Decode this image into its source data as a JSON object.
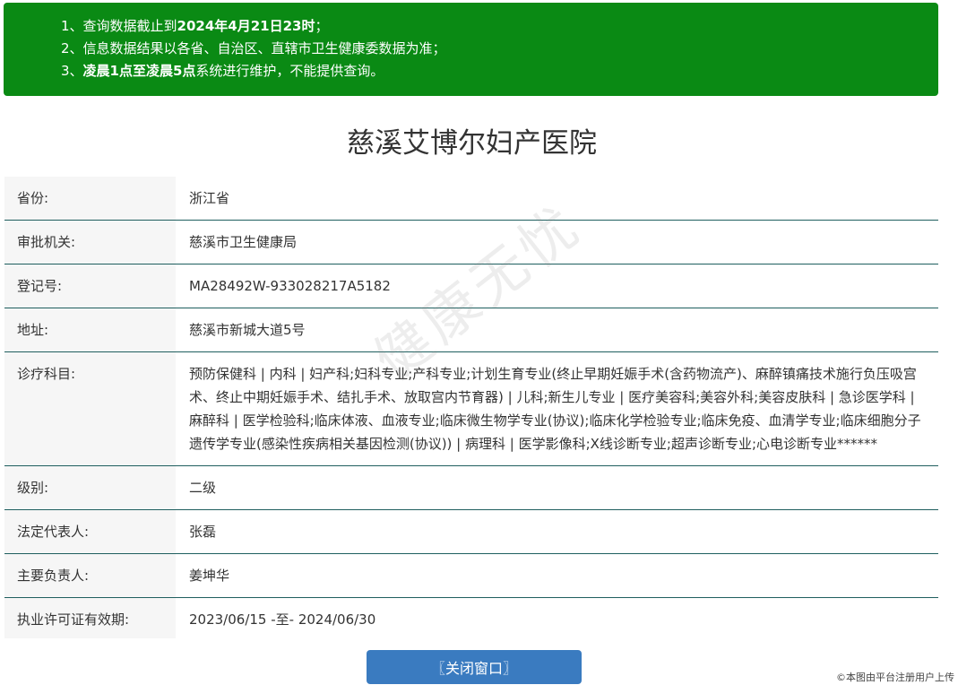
{
  "notice": {
    "line1_prefix": "1、查询数据截止到",
    "line1_bold": "2024年4月21日23时",
    "line1_suffix": "；",
    "line2": "2、信息数据结果以各省、自治区、直辖市卫生健康委数据为准；",
    "line3_prefix": "3、",
    "line3_bold": "凌晨1点至凌晨5点",
    "line3_suffix": "系统进行维护，不能提供查询。"
  },
  "hospital": {
    "name": "慈溪艾博尔妇产医院"
  },
  "fields": [
    {
      "label": "省份:",
      "value": "浙江省"
    },
    {
      "label": "审批机关:",
      "value": "慈溪市卫生健康局"
    },
    {
      "label": "登记号:",
      "value": "MA28492W-933028217A5182"
    },
    {
      "label": "地址:",
      "value": "慈溪市新城大道5号"
    },
    {
      "label": "诊疗科目:",
      "value": "预防保健科 | 内科 | 妇产科;妇科专业;产科专业;计划生育专业(终止早期妊娠手术(含药物流产)、麻醉镇痛技术施行负压吸宫术、终止中期妊娠手术、结扎手术、放取宫内节育器) | 儿科;新生儿专业 | 医疗美容科;美容外科;美容皮肤科 | 急诊医学科 | 麻醉科 | 医学检验科;临床体液、血液专业;临床微生物学专业(协议);临床化学检验专业;临床免疫、血清学专业;临床细胞分子遗传学专业(感染性疾病相关基因检测(协议)) | 病理科 | 医学影像科;X线诊断专业;超声诊断专业;心电诊断专业******"
    },
    {
      "label": "级别:",
      "value": "二级"
    },
    {
      "label": "法定代表人:",
      "value": "张磊"
    },
    {
      "label": "主要负责人:",
      "value": "姜坤华"
    },
    {
      "label": "执业许可证有效期:",
      "value": "2023/06/15 -至- 2024/06/30"
    }
  ],
  "watermark": "健康无忧",
  "close_button": "〖关闭窗口〗",
  "credit": "©本图由平台注册用户上传"
}
